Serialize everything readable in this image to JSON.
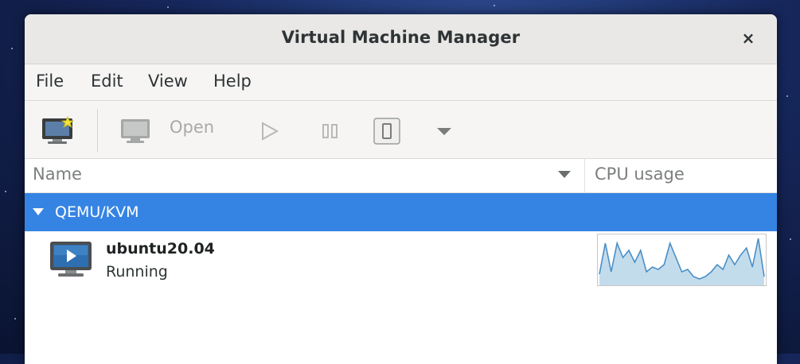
{
  "window": {
    "title": "Virtual Machine Manager",
    "close_glyph": "×"
  },
  "menu": {
    "items": [
      "File",
      "Edit",
      "View",
      "Help"
    ]
  },
  "toolbar": {
    "new_vm_icon": "new-vm-icon",
    "open_label": "Open",
    "icons": [
      "monitor-icon",
      "play-icon",
      "pause-icon",
      "shutdown-icon",
      "dropdown-arrow-icon"
    ]
  },
  "columns": {
    "name": "Name",
    "cpu": "CPU usage"
  },
  "connection": {
    "label": "QEMU/KVM"
  },
  "vms": [
    {
      "name": "ubuntu20.04",
      "status": "Running",
      "cpu_usage_samples": [
        0.2,
        0.85,
        0.25,
        0.85,
        0.55,
        0.7,
        0.45,
        0.7,
        0.25,
        0.35,
        0.3,
        0.4,
        0.85,
        0.55,
        0.25,
        0.3,
        0.15,
        0.1,
        0.15,
        0.25,
        0.4,
        0.3,
        0.6,
        0.4,
        0.6,
        0.75,
        0.35,
        0.95,
        0.15
      ]
    }
  ],
  "colors": {
    "selection": "#3584e4",
    "graph_line": "#4a8fc7",
    "graph_fill": "#c3dcec"
  }
}
